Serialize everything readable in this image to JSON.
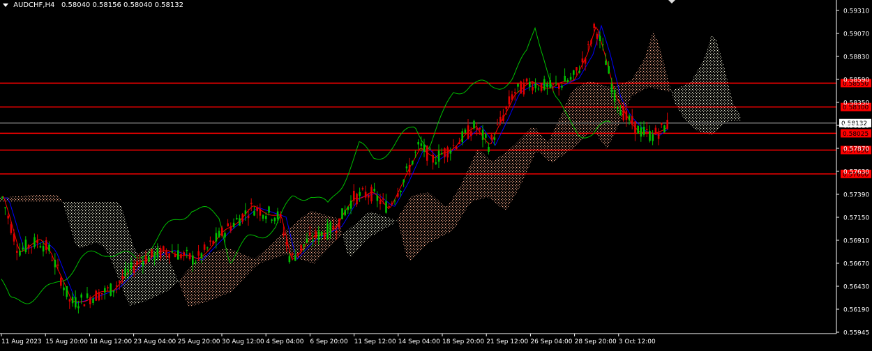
{
  "header": {
    "symbol": "AUDCHF,H4",
    "open": "0.58040",
    "high": "0.58156",
    "low": "0.58040",
    "close": "0.58132"
  },
  "colors": {
    "background": "#000000",
    "axis": "#ffffff",
    "bull_candle": "#00c000",
    "bear_candle": "#e00000",
    "level_line": "#ff0000",
    "current_price_line": "#c0c0c0",
    "tenkan": "#ff0000",
    "kijun": "#0000ff",
    "chikou": "#00c000",
    "cloud_a": "#f5f5dc",
    "cloud_b": "#ffb090"
  },
  "chart_data": {
    "type": "candlestick",
    "symbol": "AUDCHF",
    "timeframe": "H4",
    "indicators": [
      "Ichimoku Kinko Hyo"
    ],
    "y_axis": {
      "range": [
        0.55945,
        0.5931
      ],
      "tick_labels": [
        "0.59310",
        "0.59070",
        "0.58830",
        "0.58590",
        "0.58350",
        "0.58110",
        "0.57870",
        "0.57630",
        "0.57390",
        "0.57150",
        "0.56910",
        "0.56670",
        "0.56430",
        "0.56190",
        "0.55945"
      ]
    },
    "x_axis": {
      "tick_labels": [
        "11 Aug 2023",
        "15 Aug 20:00",
        "18 Aug 12:00",
        "23 Aug 04:00",
        "25 Aug 20:00",
        "30 Aug 12:00",
        "4 Sep 04:00",
        "6 Sep 20:00",
        "11 Sep 12:00",
        "14 Sep 04:00",
        "18 Sep 20:00",
        "21 Sep 12:00",
        "26 Sep 04:00",
        "28 Sep 20:00",
        "3 Oct 12:00"
      ]
    },
    "current_price": "0.58132",
    "horizontal_levels": [
      {
        "value": 0.5855,
        "label": "0.58550"
      },
      {
        "value": 0.583,
        "label": "0.58300"
      },
      {
        "value": 0.58025,
        "label": "0.58025"
      },
      {
        "value": 0.5785,
        "label": "0.57850"
      },
      {
        "value": 0.576,
        "label": "0.57600"
      }
    ]
  }
}
